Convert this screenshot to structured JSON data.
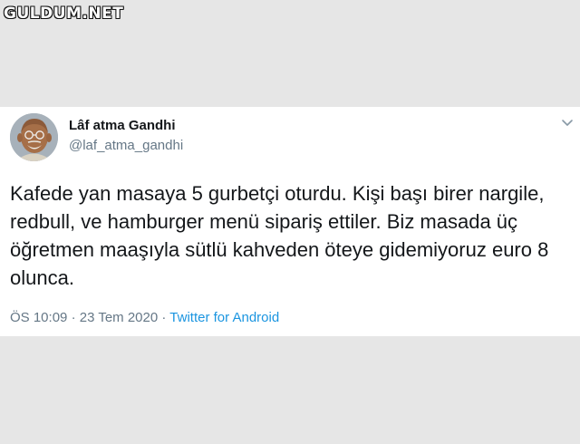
{
  "watermark": "GULDUM.NET",
  "tweet": {
    "author_name": "Lâf atma Gandhi",
    "author_handle": "@laf_atma_gandhi",
    "text": "Kafede yan masaya 5 gurbetçi oturdu. Kişi başı birer nargile, redbull, ve hamburger menü sipariş ettiler. Biz masada üç öğretmen maaşıyla sütlü kahveden öteye gidemiyoruz euro 8 olunca.",
    "time": "ÖS 10:09",
    "separator_1": "·",
    "date": "23 Tem 2020",
    "separator_2": "·",
    "source": "Twitter for Android",
    "menu_icon": "chevron-down-icon",
    "colors": {
      "background": "#e6e6e6",
      "card": "#ffffff",
      "text": "#14171a",
      "muted": "#657786",
      "link": "#1b95e0"
    }
  }
}
